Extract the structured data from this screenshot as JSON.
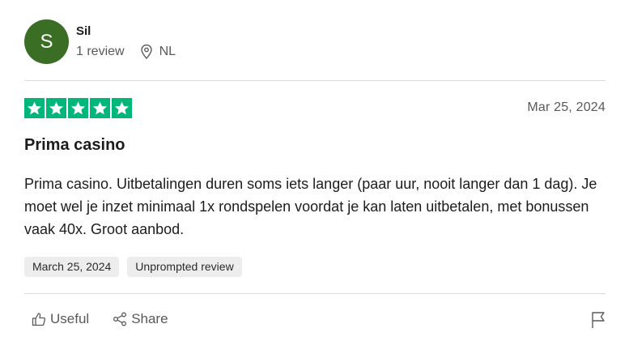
{
  "reviewer": {
    "initial": "S",
    "name": "Sil",
    "reviews": "1 review",
    "country": "NL",
    "avatar_color": "#3a6e25"
  },
  "review": {
    "rating": 5,
    "star_color": "#00b67a",
    "date": "Mar 25, 2024",
    "title": "Prima casino",
    "text": "Prima casino. Uitbetalingen duren soms iets langer (paar uur, nooit langer dan 1 dag). Je moet wel je inzet minimaal 1x rondspelen voordat je kan laten uitbetalen, met bonussen vaak 40x. Groot aanbod.",
    "tags": [
      "March 25, 2024",
      "Unprompted review"
    ]
  },
  "actions": {
    "useful_label": "Useful",
    "share_label": "Share",
    "icons": [
      "thumbs-up-icon",
      "share-icon",
      "flag-icon"
    ]
  }
}
